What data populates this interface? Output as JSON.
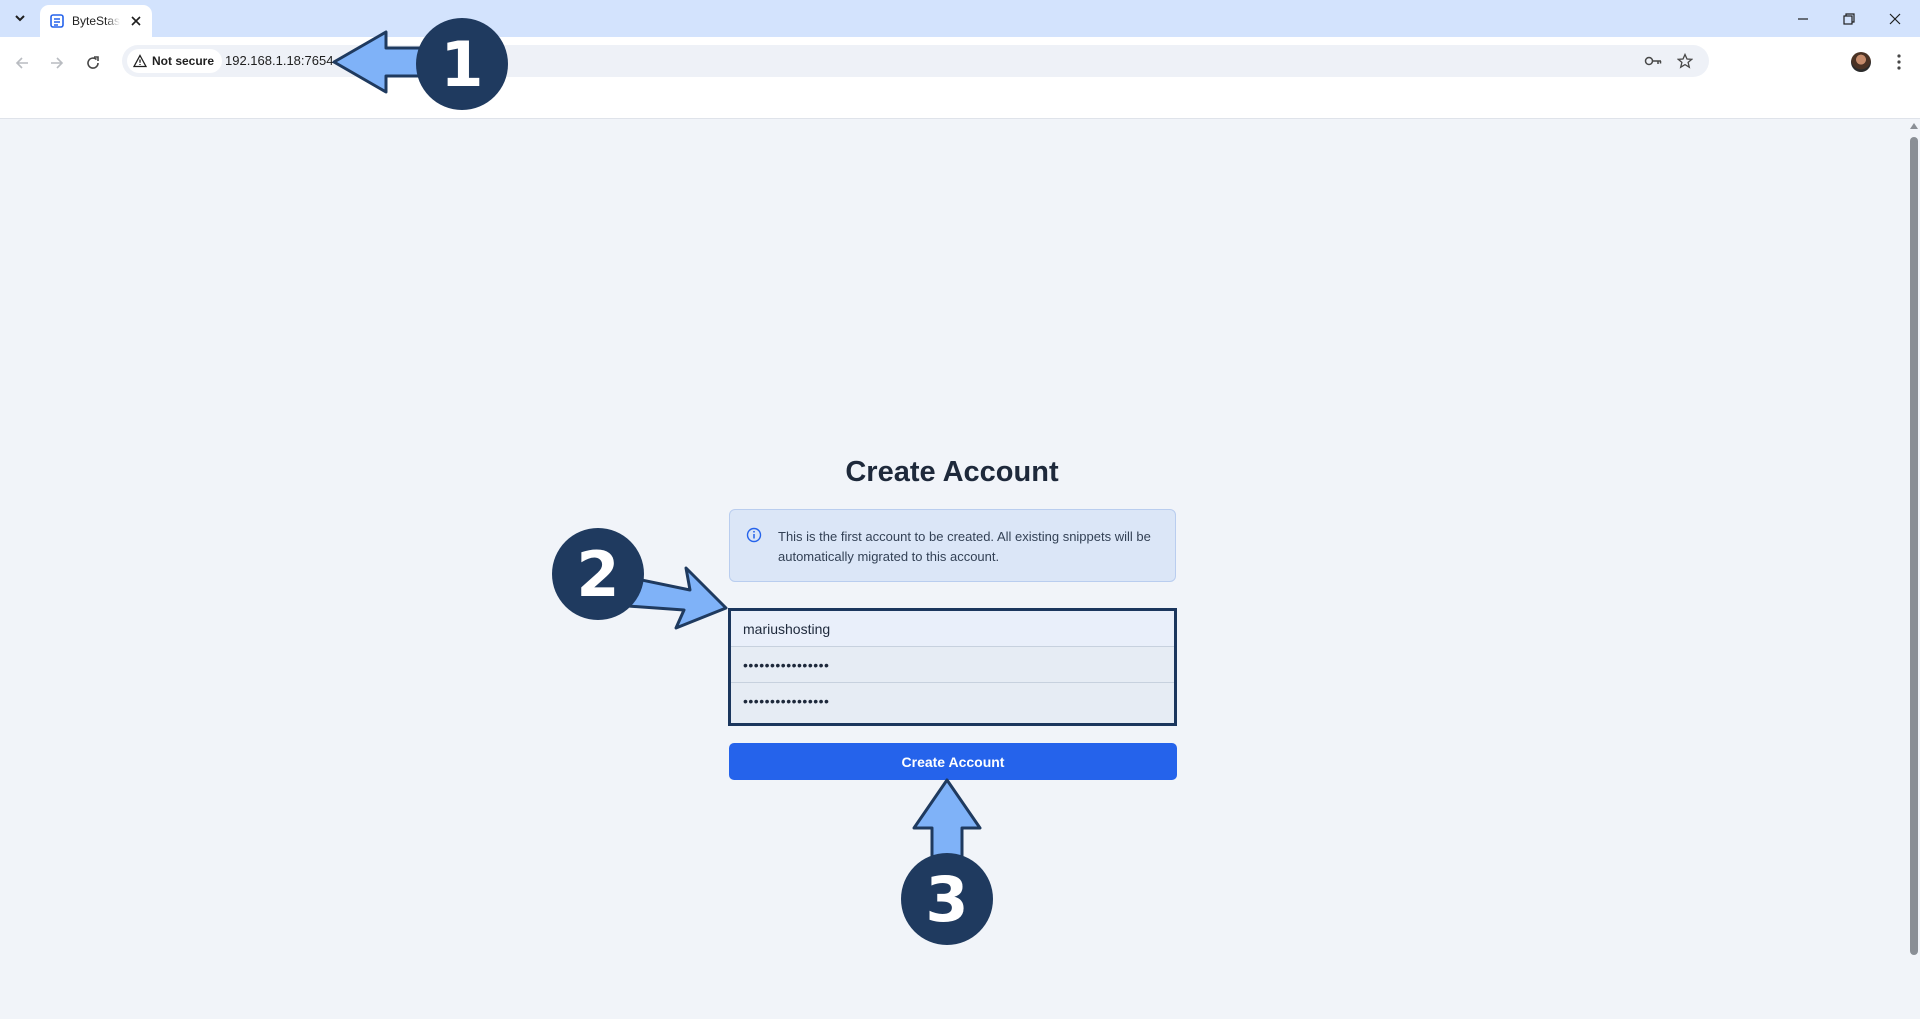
{
  "browser": {
    "tab": {
      "title": "ByteStash"
    },
    "address_bar": {
      "security_label": "Not secure",
      "url": "192.168.1.18:7654"
    }
  },
  "page": {
    "title": "Create Account",
    "info_message": "This is the first account to be created. All existing snippets will be automatically migrated to this account.",
    "form": {
      "username_value": "mariushosting",
      "password_value": "••••••••••••••••",
      "confirm_password_value": "••••••••••••••••",
      "submit_label": "Create Account"
    }
  },
  "annotations": [
    {
      "number": "1",
      "label": "1"
    },
    {
      "number": "2",
      "label": "2"
    },
    {
      "number": "3",
      "label": "3"
    }
  ],
  "colors": {
    "accent": "#2563eb",
    "annotation_badge": "#1f3a5f",
    "annotation_arrow": "#7fb2f8",
    "tabstrip": "#d3e3fd",
    "page_bg": "#f1f4f9"
  }
}
